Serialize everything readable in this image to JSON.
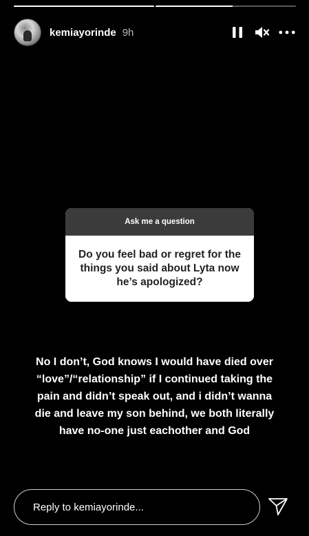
{
  "progress": {
    "segments": 2,
    "current_segment_fill": 0.55
  },
  "header": {
    "username": "kemiayorinde",
    "time": "9h",
    "icons": [
      "pause-icon",
      "mute-icon",
      "more-icon"
    ]
  },
  "sticker": {
    "title": "Ask me a question",
    "question": "Do you feel bad or regret for the things you said about Lyta now he’s apologized?"
  },
  "answer": {
    "text": "No I don’t, God knows I would have died over “love”/“relationship” if I continued taking the pain and didn’t speak out, and i didn’t wanna die and leave my son behind, we both literally have no-one just eachother and God"
  },
  "reply": {
    "placeholder": "Reply to kemiayorinde..."
  },
  "colors": {
    "background": "#000000",
    "sticker_header": "#3b3b3b",
    "sticker_body": "#ffffff",
    "text": "#ffffff",
    "muted_text": "#bdbdbd"
  }
}
